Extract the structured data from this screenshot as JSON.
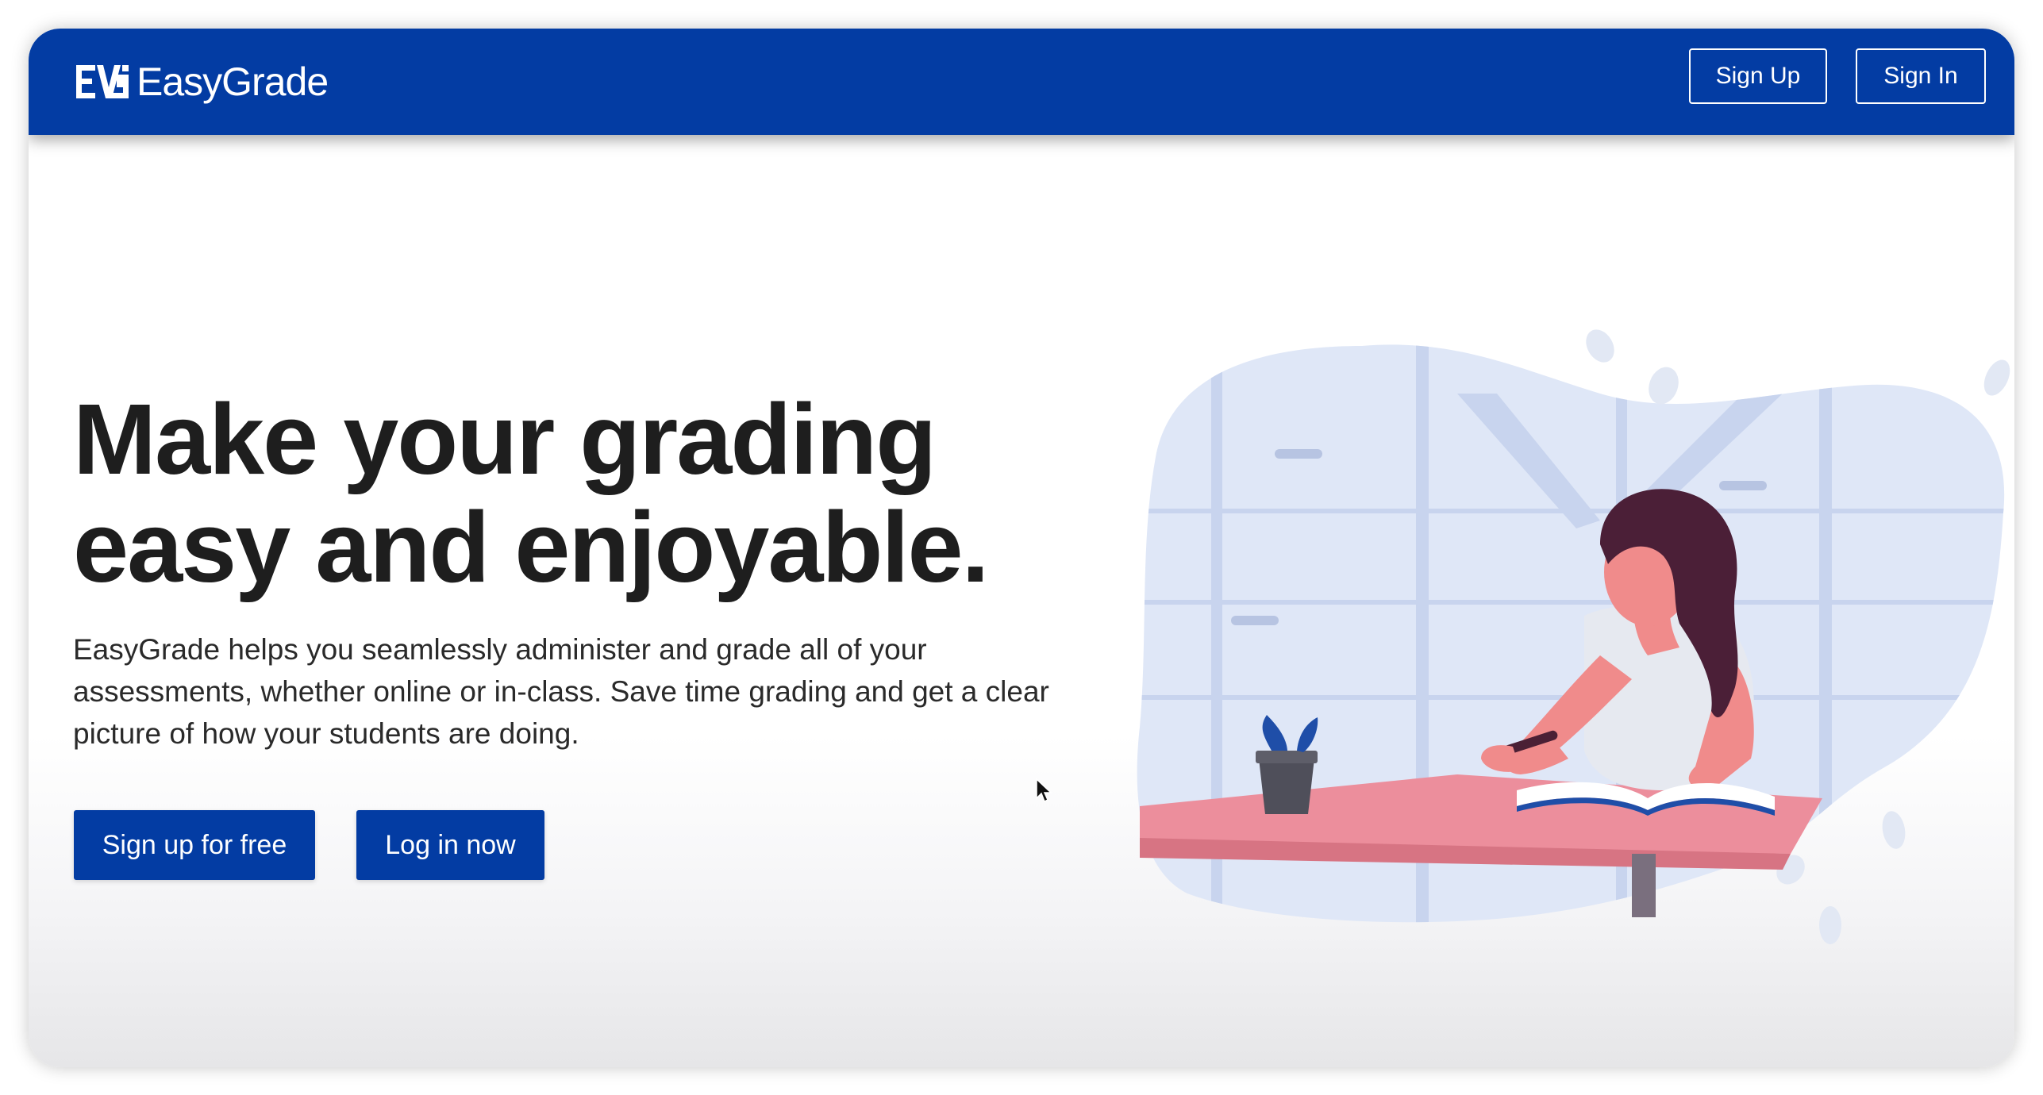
{
  "navbar": {
    "brand": "EasyGrade",
    "logo_icon": "easygrade-logo-icon",
    "sign_up_label": "Sign Up",
    "sign_in_label": "Sign In"
  },
  "hero": {
    "headline_line1": "Make your grading",
    "headline_line2": "easy and enjoyable.",
    "description": "EasyGrade helps you seamlessly administer and grade all of your assessments, whether online or in-class. Save time grading and get a clear picture of how your students are doing.",
    "cta_primary": "Sign up for free",
    "cta_secondary": "Log in now",
    "illustration_icon": "woman-writing-illustration"
  },
  "colors": {
    "brand_blue": "#033ca3",
    "text_dark": "#1e1e1e",
    "illustration_bg": "#dfe7f7",
    "skin": "#f08b8b",
    "hair": "#4b1f37",
    "desk": "#e88a96"
  }
}
